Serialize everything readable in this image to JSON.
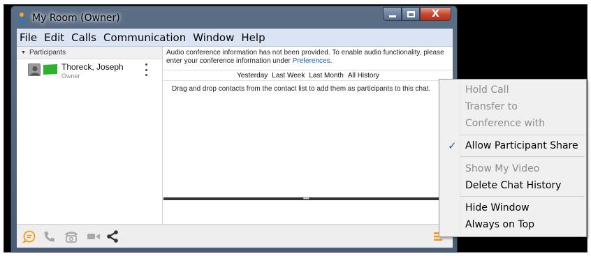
{
  "window": {
    "title": "My Room (Owner)",
    "close_glyph": "X"
  },
  "menubar": {
    "items": [
      "File",
      "Edit",
      "Calls",
      "Communication",
      "Window",
      "Help"
    ]
  },
  "participants": {
    "header": "Participants",
    "rows": [
      {
        "name": "Thoreck, Joseph",
        "role": "Owner",
        "status_color": "#2fb12f"
      }
    ]
  },
  "conversation": {
    "audio_info_text": "Audio conference information has not been provided. To enable audio functionality, please enter your conference information under ",
    "audio_info_link": "Preferences",
    "audio_info_tail": ".",
    "history_filters": [
      "Yesterday",
      "Last Week",
      "Last Month",
      "All History"
    ],
    "drag_drop_tip": "Drag and drop contacts from the contact list to add them as participants to this chat.",
    "splitter_glyph": "•••"
  },
  "toolbar": {
    "icons": [
      "chat-icon",
      "phone-icon",
      "conference-phone-icon",
      "video-camera-icon",
      "share-icon",
      "menu-icon"
    ],
    "accent_color": "#f39a1e",
    "disabled_color": "#a8a8a8"
  },
  "context_menu": {
    "check_glyph": "✓",
    "items": [
      {
        "label": "Hold Call",
        "enabled": false
      },
      {
        "label": "Transfer to",
        "enabled": false
      },
      {
        "label": "Conference with",
        "enabled": false
      },
      {
        "label": "Allow Participant Share",
        "enabled": true,
        "checked": true
      },
      {
        "label": "Show My Video",
        "enabled": false
      },
      {
        "label": "Delete Chat History",
        "enabled": true
      },
      {
        "label": "Hide Window",
        "enabled": true
      },
      {
        "label": "Always on Top",
        "enabled": true
      }
    ]
  }
}
